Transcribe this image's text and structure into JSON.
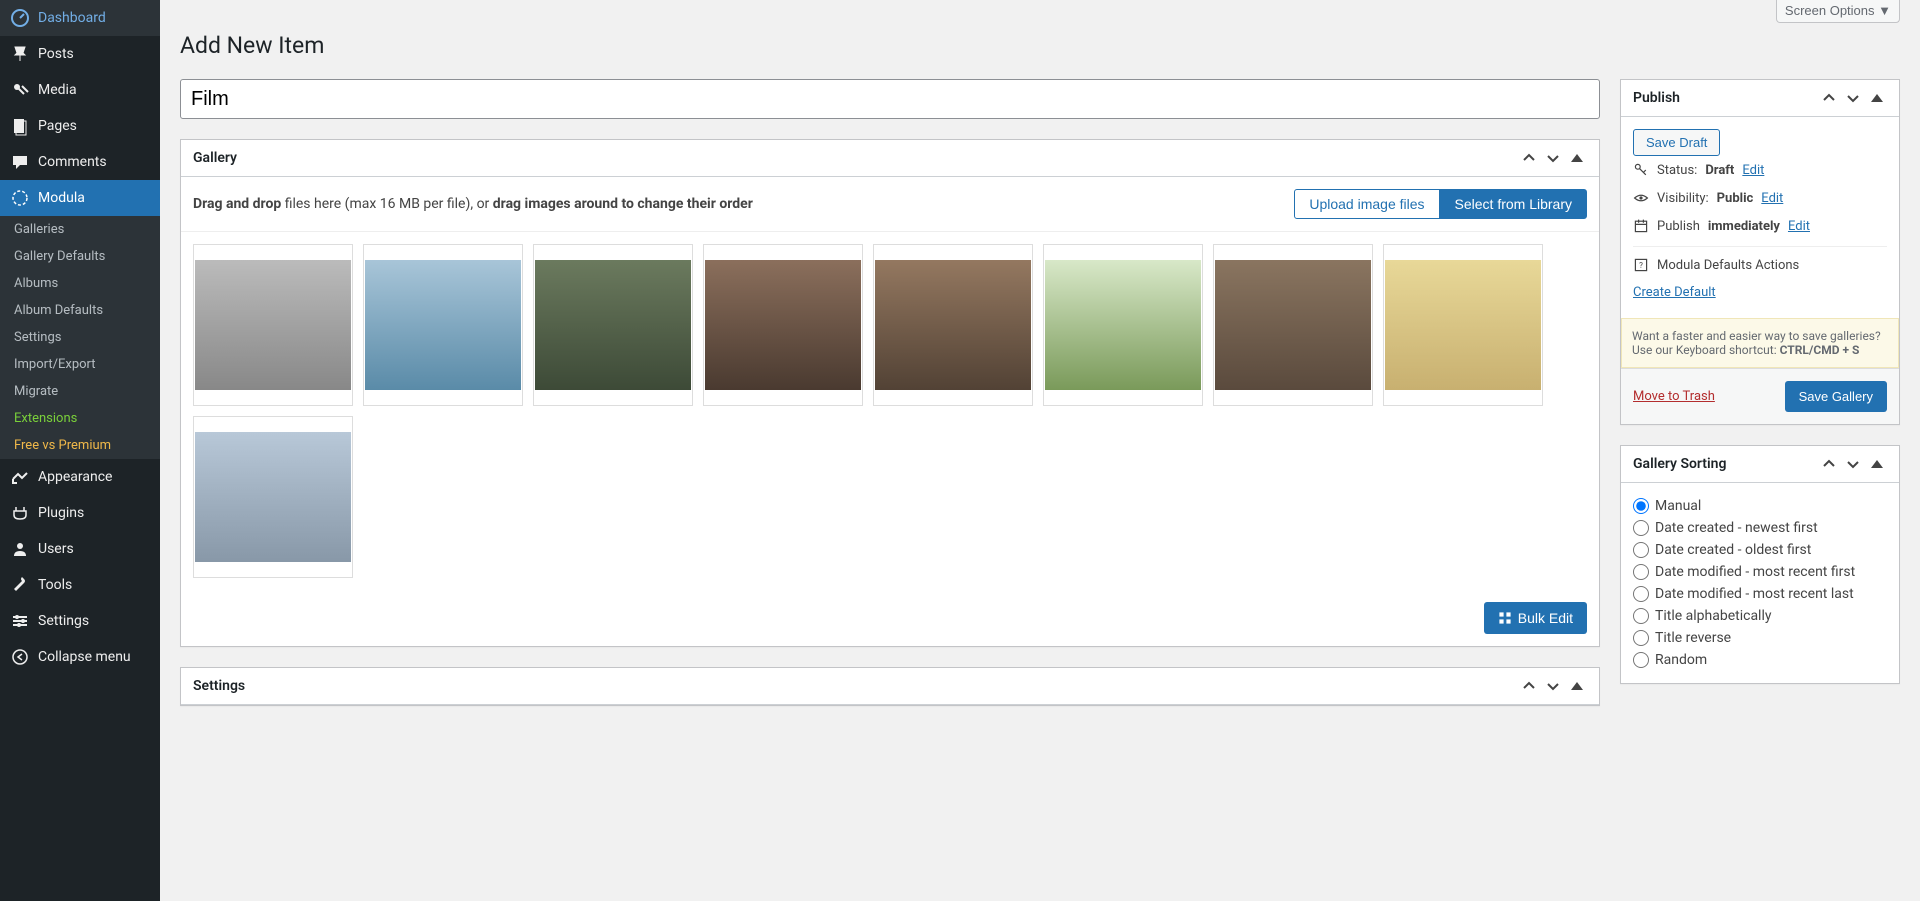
{
  "screen_options_label": "Screen Options ▼",
  "sidebar": {
    "items": [
      {
        "label": "Dashboard",
        "icon": "dashboard"
      },
      {
        "label": "Posts",
        "icon": "pin"
      },
      {
        "label": "Media",
        "icon": "media"
      },
      {
        "label": "Pages",
        "icon": "pages"
      },
      {
        "label": "Comments",
        "icon": "comments"
      },
      {
        "label": "Modula",
        "icon": "modula",
        "active": true
      },
      {
        "label": "Appearance",
        "icon": "appearance"
      },
      {
        "label": "Plugins",
        "icon": "plugins"
      },
      {
        "label": "Users",
        "icon": "users"
      },
      {
        "label": "Tools",
        "icon": "tools"
      },
      {
        "label": "Settings",
        "icon": "settings"
      },
      {
        "label": "Collapse menu",
        "icon": "collapse"
      }
    ],
    "submenu": [
      {
        "label": "Galleries"
      },
      {
        "label": "Gallery Defaults"
      },
      {
        "label": "Albums"
      },
      {
        "label": "Album Defaults"
      },
      {
        "label": "Settings"
      },
      {
        "label": "Import/Export"
      },
      {
        "label": "Migrate"
      },
      {
        "label": "Extensions",
        "class": "ext"
      },
      {
        "label": "Free vs Premium",
        "class": "premium"
      }
    ]
  },
  "page_title": "Add New Item",
  "title_value": "Film",
  "gallery": {
    "title": "Gallery",
    "hint_prefix": "Drag and drop",
    "hint_mid": " files here (max 16 MB per file), or ",
    "hint_suffix": "drag images around to change their order",
    "upload_btn": "Upload image files",
    "library_btn": "Select from Library",
    "bulk_edit": "Bulk Edit"
  },
  "settings_box_title": "Settings",
  "publish": {
    "title": "Publish",
    "save_draft": "Save Draft",
    "status_label": "Status:",
    "status_value": "Draft",
    "status_edit": "Edit",
    "visibility_label": "Visibility:",
    "visibility_value": "Public",
    "visibility_edit": "Edit",
    "publish_label": "Publish",
    "publish_value": "immediately",
    "publish_edit": "Edit",
    "defaults_label": "Modula Defaults Actions",
    "create_default": "Create Default",
    "promo_text": "Want a faster and easier way to save galleries? Use our Keyboard shortcut: ",
    "promo_shortcut": "CTRL/CMD + S",
    "trash": "Move to Trash",
    "save_gallery": "Save Gallery"
  },
  "sorting": {
    "title": "Gallery Sorting",
    "options": [
      "Manual",
      "Date created - newest first",
      "Date created - oldest first",
      "Date modified - most recent first",
      "Date modified - most recent last",
      "Title alphabetically",
      "Title reverse",
      "Random"
    ],
    "selected": "Manual"
  }
}
